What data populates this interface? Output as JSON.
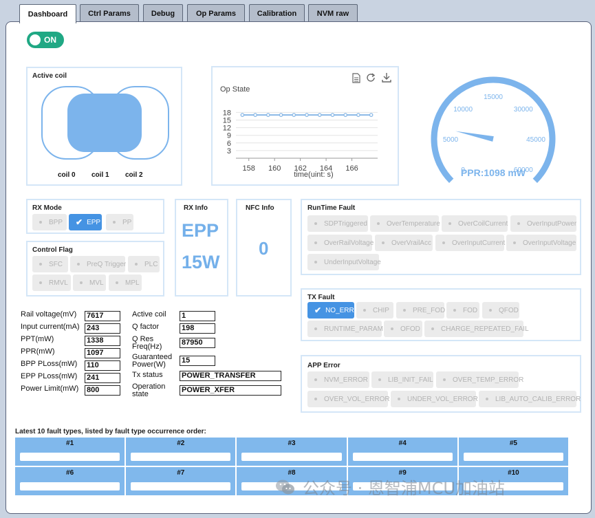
{
  "tabs": [
    "Dashboard",
    "Ctrl Params",
    "Debug",
    "Op Params",
    "Calibration",
    "NVM raw"
  ],
  "toggle": {
    "label": "ON",
    "state": true
  },
  "active_coil": {
    "title": "Active coil",
    "labels": [
      "coil 0",
      "coil 1",
      "coil 2"
    ]
  },
  "op_state": {
    "title": "Op State",
    "icons": [
      "document-icon",
      "refresh-icon",
      "download-icon"
    ],
    "chart_data": {
      "type": "line",
      "title": "Op State",
      "xlabel": "time(uint: s)",
      "ylabel": "",
      "x": [
        157.5,
        158.5,
        159.5,
        160.5,
        161.5,
        162.5,
        163.5,
        164.5,
        165.5,
        166.5,
        167.5
      ],
      "values": [
        17,
        17,
        17,
        17,
        17,
        17,
        17,
        17,
        17,
        17,
        17
      ],
      "xticks": [
        "158",
        "160",
        "162",
        "164",
        "166"
      ],
      "yticks": [
        "3",
        "6",
        "9",
        "12",
        "15",
        "18"
      ],
      "xlim": [
        157,
        168
      ],
      "ylim": [
        0,
        20
      ],
      "grid": true,
      "color": "#89b8e6"
    }
  },
  "gauge": {
    "ticks": [
      "0",
      "5000",
      "10000",
      "15000",
      "30000",
      "45000",
      "60000"
    ],
    "readout": "PPR:1098 mW",
    "value_fraction": 0.21,
    "color": "#7cb4ec"
  },
  "rx_mode": {
    "title": "RX Mode",
    "options": [
      "BPP",
      "EPP",
      "PP"
    ],
    "selected": "EPP"
  },
  "rx_info": {
    "title": "RX Info",
    "mode": "EPP",
    "power": "15W"
  },
  "nfc_info": {
    "title": "NFC Info",
    "value": "0"
  },
  "control_flag": {
    "title": "Control Flag",
    "row1": [
      "SFC",
      "PreQ Trigger",
      "PLC"
    ],
    "row2": [
      "RMVL",
      "MVL",
      "MPL"
    ]
  },
  "runtime_fault": {
    "title": "RunTime Fault",
    "row1": [
      "SDPTriggered",
      "OverTemperature",
      "OverCoilCurrent",
      "OverInputPower"
    ],
    "row2": [
      "OverRailVoltage",
      "OverVrailAcc",
      "OverInputCurrent",
      "OverInputVoltage"
    ],
    "row3": [
      "UnderInputVoltage"
    ]
  },
  "tx_fault": {
    "title": "TX Fault",
    "row1": [
      "NO_ERR",
      "CHIP",
      "PRE_FOD",
      "FOD",
      "QFOD"
    ],
    "row2": [
      "RUNTIME_PARAM",
      "OFOD",
      "CHARGE_REPEATED_FAIL"
    ],
    "selected": "NO_ERR"
  },
  "app_error": {
    "title": "APP Error",
    "row1": [
      "NVM_ERROR",
      "LIB_INIT_FAIL",
      "OVER_TEMP_ERROR"
    ],
    "row2": [
      "OVER_VOL_ERROR",
      "UNDER_VOL_ERROR",
      "LIB_AUTO_CALIB_ERROR"
    ]
  },
  "params_left": [
    {
      "label": "Rail voltage(mV)",
      "value": "7617"
    },
    {
      "label": "Input current(mA)",
      "value": "243"
    },
    {
      "label": "PPT(mW)",
      "value": "1338"
    },
    {
      "label": "PPR(mW)",
      "value": "1097"
    },
    {
      "label": "BPP PLoss(mW)",
      "value": "110"
    },
    {
      "label": "EPP PLoss(mW)",
      "value": "241"
    },
    {
      "label": "Power Limit(mW)",
      "value": "800"
    }
  ],
  "params_right": [
    {
      "label": "Active coil",
      "value": "1"
    },
    {
      "label": "Q factor",
      "value": "198"
    },
    {
      "label": "Q Res Freq(Hz)",
      "value": "87950"
    },
    {
      "label": "Guaranteed Power(W)",
      "value": "15"
    },
    {
      "label": "Tx status",
      "value": "POWER_TRANSFER"
    },
    {
      "label": "Operation state",
      "value": "POWER_XFER"
    }
  ],
  "fault_history": {
    "title": "Latest 10 fault types, listed by fault type occurrence order:",
    "row1": [
      "#1",
      "#2",
      "#3",
      "#4",
      "#5"
    ],
    "row2": [
      "#6",
      "#7",
      "#8",
      "#9",
      "#10"
    ]
  },
  "watermark": "公众号 · 恩智浦MCU加油站"
}
